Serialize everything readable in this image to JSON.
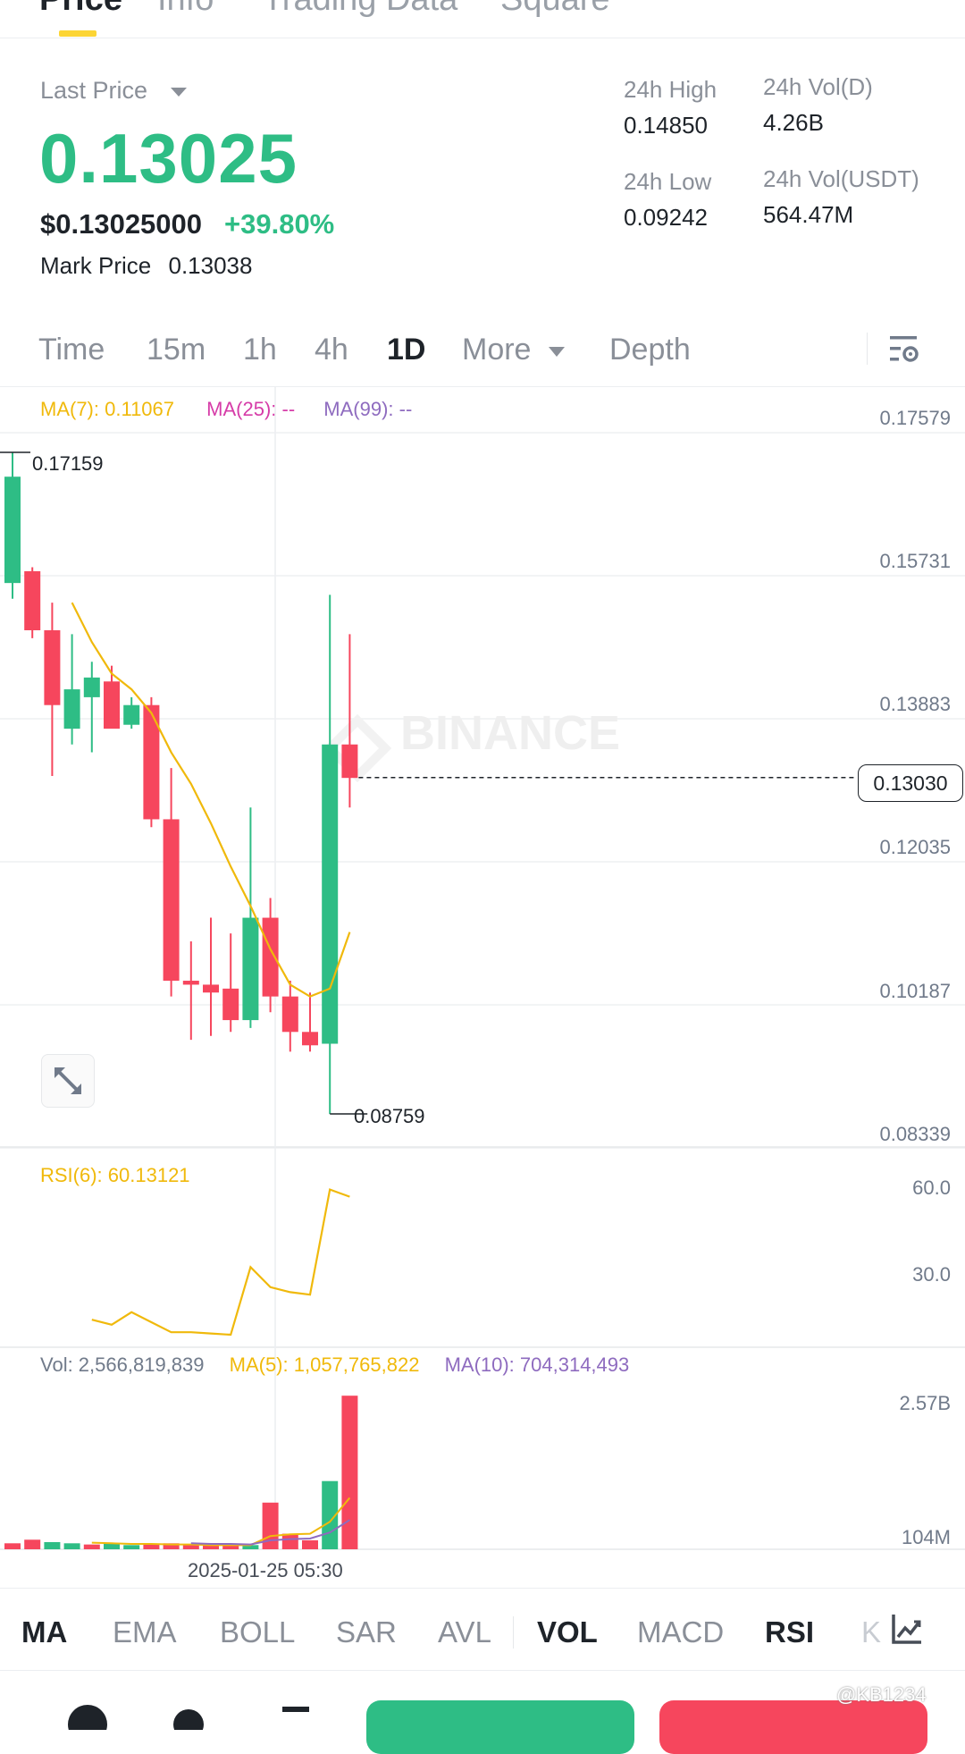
{
  "top_tabs": [
    "Price",
    "Info",
    "Trading Data",
    "Square"
  ],
  "ticker": {
    "last_price_label": "Last Price",
    "last_price": "0.13025",
    "usd_price": "$0.13025000",
    "change_pct": "+39.80%",
    "mark_price_label": "Mark Price",
    "mark_price": "0.13038",
    "high_label": "24h High",
    "high": "0.14850",
    "low_label": "24h Low",
    "low": "0.09242",
    "vol_d_label": "24h Vol(D)",
    "vol_d": "4.26B",
    "vol_usdt_label": "24h Vol(USDT)",
    "vol_usdt": "564.47M"
  },
  "timeframes": [
    "Time",
    "15m",
    "1h",
    "4h",
    "1D",
    "More",
    "Depth"
  ],
  "active_timeframe": "1D",
  "ma_legend": {
    "ma7": "MA(7): 0.11067",
    "ma25": "MA(25): --",
    "ma99": "MA(99): --"
  },
  "price_axis": [
    "0.17579",
    "0.15731",
    "0.13883",
    "0.12035",
    "0.10187",
    "0.08339"
  ],
  "high_marker": "0.17159",
  "low_marker": "0.08759",
  "current_price_tag": "0.13030",
  "watermark": "BINANCE",
  "rsi_legend": "RSI(6): 60.13121",
  "rsi_axis": [
    "60.0",
    "30.0"
  ],
  "vol_legend": {
    "vol": "Vol: 2,566,819,839",
    "ma5": "MA(5): 1,057,765,822",
    "ma10": "MA(10): 704,314,493"
  },
  "vol_axis": [
    "2.57B",
    "104M"
  ],
  "crosshair_time": "2025-01-25 05:30",
  "indicator_tabs": [
    "MA",
    "EMA",
    "BOLL",
    "SAR",
    "AVL",
    "VOL",
    "MACD",
    "RSI",
    "K"
  ],
  "user_watermark": "@KB1234",
  "colors": {
    "up": "#2ebd85",
    "down": "#f6465d",
    "ma7": "#f0b90b",
    "ma25": "#d63ca8",
    "ma99": "#8e6bbf",
    "accent": "#fcd535"
  },
  "chart_data": [
    {
      "type": "candlestick",
      "title": "",
      "ylim": [
        0.08339,
        0.17579
      ],
      "ohlc": [
        {
          "o": 0.155,
          "h": 0.17159,
          "l": 0.153,
          "c": 0.1685
        },
        {
          "o": 0.1565,
          "h": 0.157,
          "l": 0.148,
          "c": 0.149
        },
        {
          "o": 0.149,
          "h": 0.1525,
          "l": 0.1305,
          "c": 0.1395
        },
        {
          "o": 0.1365,
          "h": 0.1485,
          "l": 0.1345,
          "c": 0.1415
        },
        {
          "o": 0.1405,
          "h": 0.145,
          "l": 0.1335,
          "c": 0.143
        },
        {
          "o": 0.1425,
          "h": 0.1445,
          "l": 0.1375,
          "c": 0.1365
        },
        {
          "o": 0.137,
          "h": 0.1405,
          "l": 0.1365,
          "c": 0.1395
        },
        {
          "o": 0.1395,
          "h": 0.1405,
          "l": 0.124,
          "c": 0.125
        },
        {
          "o": 0.125,
          "h": 0.1315,
          "l": 0.1025,
          "c": 0.1045
        },
        {
          "o": 0.1045,
          "h": 0.1095,
          "l": 0.097,
          "c": 0.104
        },
        {
          "o": 0.104,
          "h": 0.1125,
          "l": 0.0975,
          "c": 0.103
        },
        {
          "o": 0.1035,
          "h": 0.1105,
          "l": 0.098,
          "c": 0.0995
        },
        {
          "o": 0.0995,
          "h": 0.1265,
          "l": 0.0985,
          "c": 0.1125
        },
        {
          "o": 0.1125,
          "h": 0.115,
          "l": 0.1005,
          "c": 0.1025
        },
        {
          "o": 0.1025,
          "h": 0.1045,
          "l": 0.0955,
          "c": 0.098
        },
        {
          "o": 0.098,
          "h": 0.103,
          "l": 0.0955,
          "c": 0.0963
        },
        {
          "o": 0.0965,
          "h": 0.1535,
          "l": 0.08759,
          "c": 0.1345
        },
        {
          "o": 0.1345,
          "h": 0.1485,
          "l": 0.1265,
          "c": 0.13025
        }
      ],
      "ma7": [
        null,
        null,
        null,
        0.1525,
        0.1475,
        0.1435,
        0.1415,
        0.1385,
        0.1335,
        0.1295,
        0.1245,
        0.119,
        0.114,
        0.1085,
        0.104,
        0.1025,
        0.1035,
        0.11067
      ]
    },
    {
      "type": "line",
      "title": "RSI(6)",
      "ylim": [
        0,
        80
      ],
      "series": [
        {
          "name": "RSI(6)",
          "values": [
            null,
            null,
            null,
            11,
            9,
            14,
            10,
            6,
            6,
            5.5,
            5,
            32,
            24,
            22,
            21,
            63,
            60.13
          ]
        }
      ]
    },
    {
      "type": "bar",
      "title": "Vol",
      "ylim": [
        0,
        2.57
      ],
      "values_billion": [
        0.1,
        0.16,
        0.12,
        0.1,
        0.08,
        0.1,
        0.07,
        0.08,
        0.1,
        0.08,
        0.07,
        0.08,
        0.07,
        0.78,
        0.26,
        0.15,
        1.14,
        2.567
      ],
      "up": [
        false,
        false,
        true,
        true,
        false,
        true,
        true,
        false,
        false,
        false,
        false,
        false,
        true,
        false,
        false,
        false,
        true,
        false
      ],
      "ma5_billion": [
        null,
        null,
        null,
        null,
        0.11,
        0.1,
        0.09,
        0.09,
        0.08,
        0.08,
        0.07,
        0.07,
        0.07,
        0.22,
        0.25,
        0.26,
        0.46,
        0.86
      ],
      "ma10_billion": [
        null,
        null,
        null,
        null,
        null,
        null,
        null,
        null,
        null,
        0.1,
        0.09,
        0.09,
        0.08,
        0.15,
        0.17,
        0.18,
        0.28,
        0.49
      ]
    }
  ]
}
